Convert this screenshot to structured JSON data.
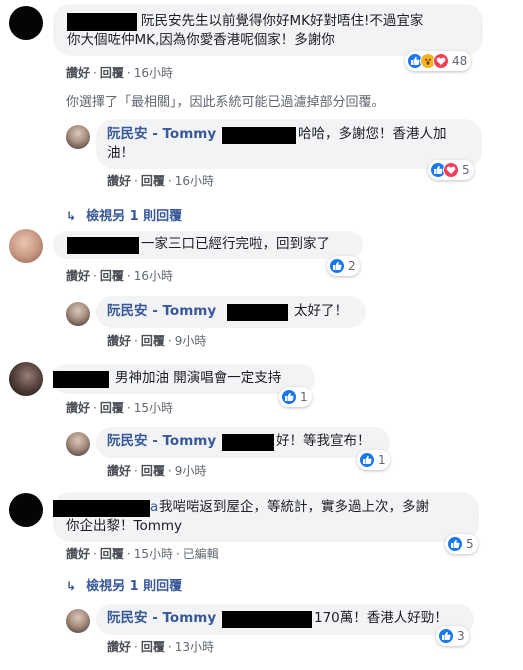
{
  "labels": {
    "like": "讚好",
    "reply": "回覆",
    "edited": "已編輯"
  },
  "notice": "你選擇了「最相關」，因此系統可能已過濾掉部分回覆。",
  "view_more": "檢視另 1 則回覆",
  "comments": [
    {
      "line1": "阮民安先生以前覺得你好MK好對唔住!不過宜家",
      "line2": "你大個咗仲MK,因為你愛香港呢個家！多謝你",
      "time": "16小時",
      "reaction_count": "48",
      "reply": {
        "name": "阮民安 - Tommy",
        "line1": "哈哈，多謝您！香港人加",
        "line2": "油！",
        "time": "16小時",
        "reaction_count": "5"
      }
    },
    {
      "line1": "一家三口已經行完啦，回到家了",
      "time": "16小時",
      "reaction_count": "2",
      "reply": {
        "name": "阮民安 - Tommy",
        "line1": "太好了！",
        "time": "9小時"
      }
    },
    {
      "line1": "男神加油 開演唱會一定支持",
      "time": "15小時",
      "reaction_count": "1",
      "reply": {
        "name": "阮民安 - Tommy",
        "line1": "好！等我宣布！",
        "time": "9小時",
        "reaction_count": "1"
      }
    },
    {
      "prefix": "a",
      "line1": "我啱啱返到屋企，等統計，實多過上次，多謝",
      "line2": "你企出黎！Tommy",
      "time": "15小時",
      "reaction_count": "5",
      "reply": {
        "name": "阮民安 - Tommy",
        "line1": "170萬！香港人好勁！",
        "time": "13小時",
        "reaction_count": "3"
      }
    }
  ],
  "icons": {
    "like": "thumbs-up-icon",
    "heart": "heart-icon",
    "wow": "wow-icon",
    "arrow": "reply-arrow-icon"
  },
  "colors": {
    "link": "#385898",
    "bubble": "#f2f3f5",
    "like": "#1877f2",
    "heart": "#f33e58",
    "wow": "#f7b125"
  }
}
